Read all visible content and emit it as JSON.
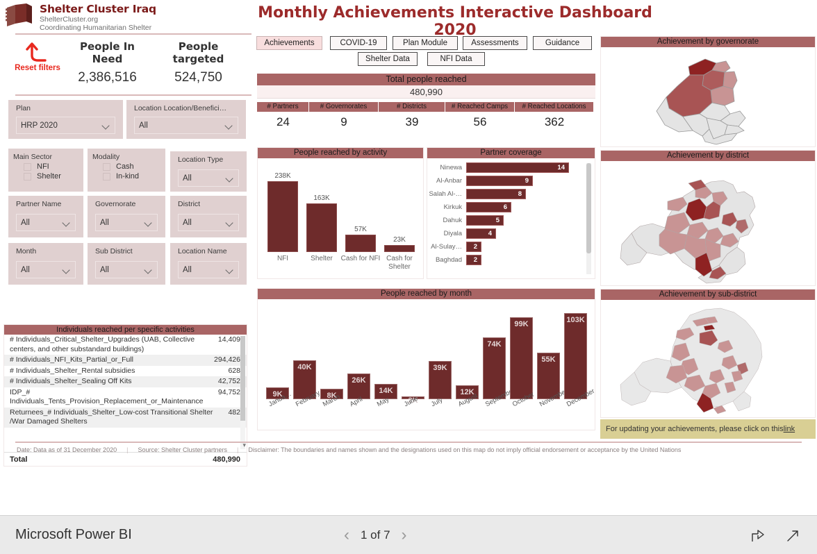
{
  "header": {
    "logo": {
      "title": "Shelter Cluster Iraq",
      "sub1": "ShelterCluster.org",
      "sub2": "Coordinating Humanitarian Shelter"
    },
    "page_title": "Monthly Achievements Interactive Dashboard 2020",
    "accent": "#9c2b2b",
    "panel_header_bg": "#a96565",
    "bar_color": "#6e2b2b"
  },
  "kpis_top": {
    "reset_label": "Reset filters",
    "people_in_need_label": "People In Need",
    "people_in_need_value": "2,386,516",
    "people_targeted_label": "People targeted",
    "people_targeted_value": "524,750"
  },
  "filters": {
    "plan": {
      "label": "Plan",
      "value": "HRP 2020"
    },
    "location_beneficiary": {
      "label": "Location Location/Benefici…",
      "value": "All"
    },
    "main_sector": {
      "label": "Main Sector",
      "options": [
        "NFI",
        "Shelter"
      ]
    },
    "modality": {
      "label": "Modality",
      "options": [
        "Cash",
        "In-kind"
      ]
    },
    "location_type": {
      "label": "Location Type",
      "value": "All"
    },
    "partner_name": {
      "label": "Partner Name",
      "value": "All"
    },
    "governorate": {
      "label": "Governorate",
      "value": "All"
    },
    "district": {
      "label": "District",
      "value": "All"
    },
    "month": {
      "label": "Month",
      "value": "All"
    },
    "sub_district": {
      "label": "Sub District",
      "value": "All"
    },
    "location_name": {
      "label": "Location Name",
      "value": "All"
    }
  },
  "activities_table": {
    "title": "Individuals reached per specific activities",
    "rows": [
      {
        "name": "# Individuals_Critical_Shelter_Upgrades (UAB, Collective centers, and other substandard buildings)",
        "value": "14,409"
      },
      {
        "name": "# Individuals_NFI_Kits_Partial_or_Full",
        "value": "294,426"
      },
      {
        "name": "# Individuals_Shelter_Rental subsidies",
        "value": "628"
      },
      {
        "name": "# Individuals_Shelter_Sealing Off Kits",
        "value": "42,752"
      },
      {
        "name": "IDP_# Individuals_Tents_Provision_Replacement_or_Maintenance",
        "value": "94,752"
      },
      {
        "name": "Returnees_# Individuals_Shelter_Low-cost Transitional Shelter /War Damaged Shelters",
        "value": "482"
      }
    ],
    "total_label": "Total",
    "total_value": "480,990"
  },
  "tabs": [
    {
      "label": "Achievements",
      "active": true
    },
    {
      "label": "COVID-19",
      "active": false
    },
    {
      "label": "Plan Module",
      "active": false
    },
    {
      "label": "Assessments",
      "active": false
    },
    {
      "label": "Guidance",
      "active": false
    },
    {
      "label": "Shelter Data",
      "active": false
    },
    {
      "label": "NFI Data",
      "active": false
    }
  ],
  "total_reached": {
    "title": "Total people reached",
    "value": "480,990"
  },
  "kpi_grid": {
    "headers": [
      "# Partners",
      "# Governorates",
      "# Districts",
      "# Reached Camps",
      "# Reached Locations"
    ],
    "values": [
      "24",
      "9",
      "39",
      "56",
      "362"
    ]
  },
  "note": {
    "text": "For updating your achievements, please click on this ",
    "link_text": "link"
  },
  "footer": {
    "date": "Date: Data as of  31 December 2020",
    "source": "Source: Shelter Cluster partners",
    "disclaimer": "Disclaimer: The boundaries and names shown and the designations used on this map do not imply official endorsement or acceptance by the United Nations"
  },
  "maps": [
    {
      "title": "Achievement by governorate"
    },
    {
      "title": "Achievement by district"
    },
    {
      "title": "Achievement by sub-district"
    }
  ],
  "powerbi": {
    "brand": "Microsoft Power BI",
    "page_indicator": "1 of 7",
    "prev_icon": "chevron-left-icon",
    "next_icon": "chevron-right-icon",
    "share_icon": "share-icon",
    "fullscreen_icon": "fullscreen-icon"
  },
  "chart_data": [
    {
      "type": "bar",
      "title": "People reached by activity",
      "categories": [
        "NFI",
        "Shelter",
        "Cash for NFI",
        "Cash for Shelter"
      ],
      "values": [
        238000,
        163000,
        57000,
        23000
      ],
      "value_labels": [
        "238K",
        "163K",
        "57K",
        "23K"
      ],
      "xlabel": "",
      "ylabel": "",
      "ylim": [
        0,
        250000
      ],
      "grid": false,
      "legend": "none"
    },
    {
      "type": "bar",
      "orientation": "horizontal",
      "title": "Partner coverage",
      "categories": [
        "Ninewa",
        "Al-Anbar",
        "Salah Al-…",
        "Kirkuk",
        "Dahuk",
        "Diyala",
        "Al-Sulay…",
        "Baghdad"
      ],
      "values": [
        14,
        9,
        8,
        6,
        5,
        4,
        2,
        2
      ],
      "value_labels": [
        "14",
        "9",
        "8",
        "6",
        "5",
        "4",
        "2",
        "2"
      ],
      "xlabel": "",
      "ylabel": "",
      "xlim": [
        0,
        14
      ],
      "grid": false,
      "legend": "none"
    },
    {
      "type": "bar",
      "title": "People reached by month",
      "categories": [
        "Janua…",
        "February",
        "March",
        "April",
        "May",
        "June",
        "July",
        "August",
        "September",
        "October",
        "November",
        "December"
      ],
      "values": [
        9000,
        40000,
        8000,
        26000,
        14000,
        2000,
        39000,
        12000,
        74000,
        99000,
        55000,
        103000
      ],
      "value_labels": [
        "9K",
        "40K",
        "8K",
        "26K",
        "14K",
        "2K",
        "39K",
        "12K",
        "74K",
        "99K",
        "55K",
        "103K"
      ],
      "xlabel": "",
      "ylabel": "",
      "ylim": [
        0,
        110000
      ],
      "grid": false,
      "legend": "none"
    }
  ]
}
